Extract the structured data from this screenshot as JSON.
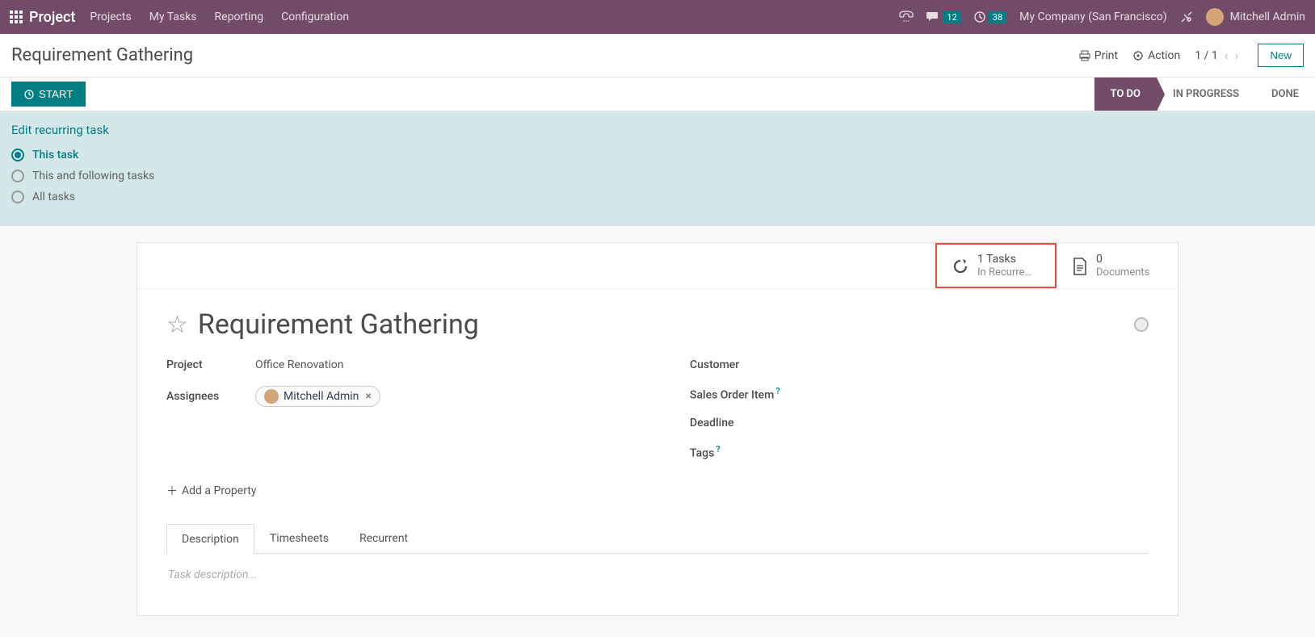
{
  "navbar": {
    "brand": "Project",
    "links": [
      "Projects",
      "My Tasks",
      "Reporting",
      "Configuration"
    ],
    "messages_count": "12",
    "activities_count": "38",
    "company": "My Company (San Francisco)",
    "user": "Mitchell Admin"
  },
  "header": {
    "breadcrumb": "Requirement Gathering",
    "print": "Print",
    "action": "Action",
    "pager": "1 / 1",
    "new": "New"
  },
  "statusbar": {
    "start": "START",
    "stages": [
      "TO DO",
      "IN PROGRESS",
      "DONE"
    ],
    "active_stage": 0
  },
  "recur": {
    "title": "Edit recurring task",
    "options": [
      "This task",
      "This and following tasks",
      "All tasks"
    ],
    "selected": 0
  },
  "stats": {
    "tasks": {
      "count": "1 Tasks",
      "sub": "In Recurre…"
    },
    "docs": {
      "count": "0",
      "sub": "Documents"
    }
  },
  "task": {
    "title": "Requirement Gathering",
    "project_label": "Project",
    "project_value": "Office Renovation",
    "assignees_label": "Assignees",
    "assignee_name": "Mitchell Admin",
    "customer_label": "Customer",
    "soi_label": "Sales Order Item",
    "deadline_label": "Deadline",
    "tags_label": "Tags",
    "add_property": "Add a Property"
  },
  "tabs": {
    "items": [
      "Description",
      "Timesheets",
      "Recurrent"
    ],
    "active": 0,
    "placeholder": "Task description..."
  }
}
